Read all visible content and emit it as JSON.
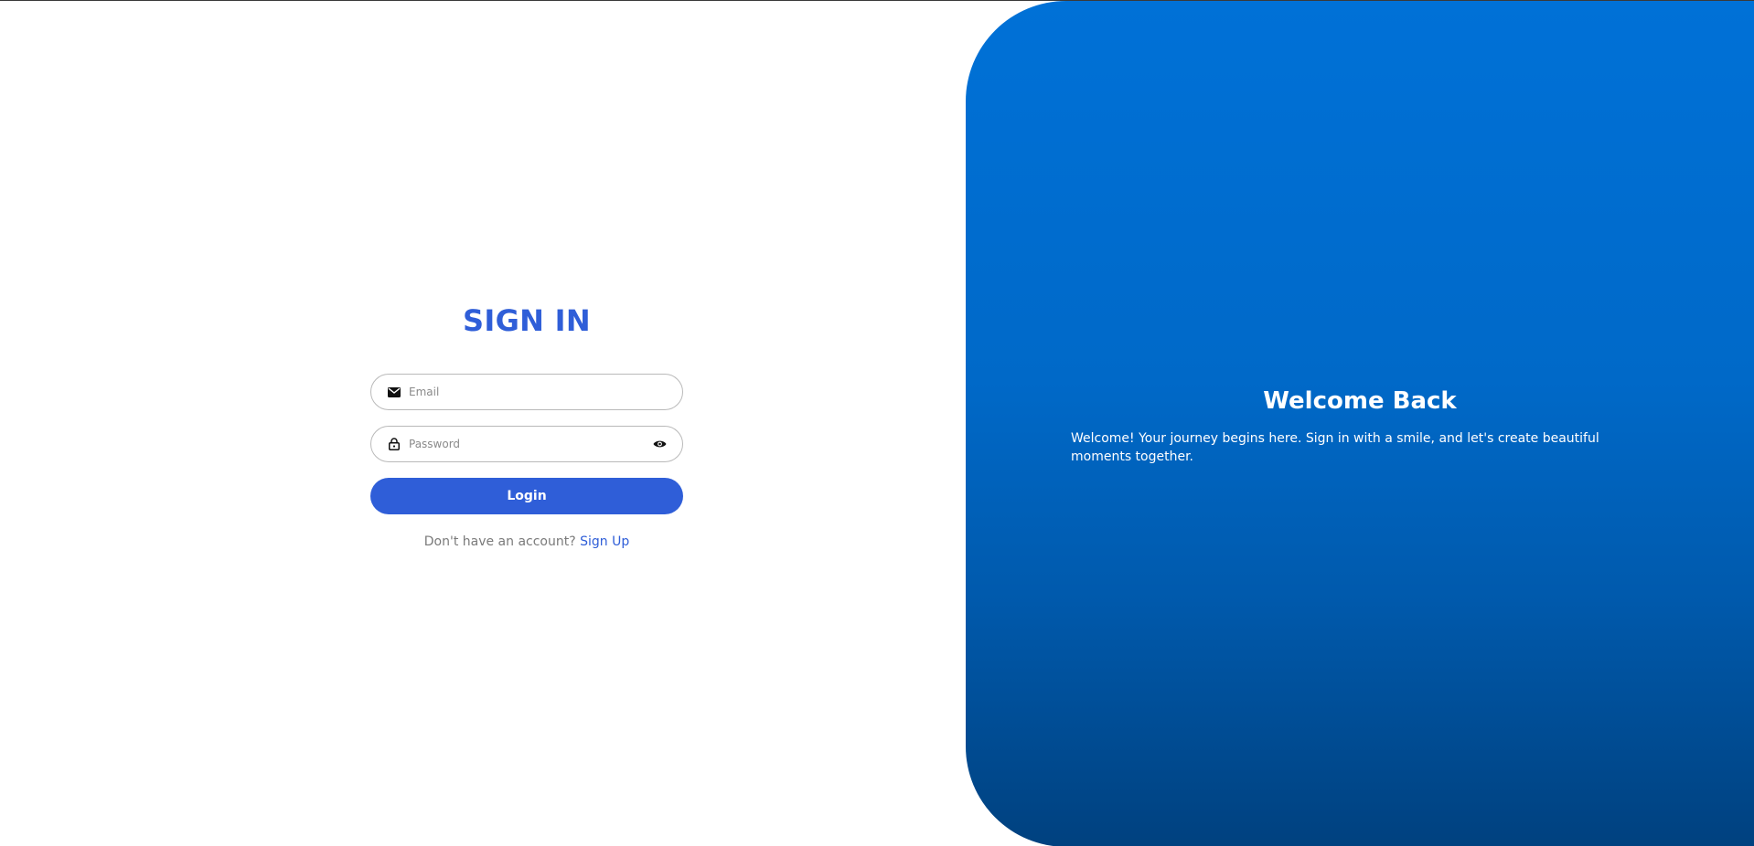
{
  "signin": {
    "title": "SIGN IN",
    "email": {
      "placeholder": "Email",
      "value": ""
    },
    "password": {
      "placeholder": "Password",
      "value": ""
    },
    "login_label": "Login",
    "signup_prompt": "Don't have an account?",
    "signup_link": "Sign Up"
  },
  "welcome": {
    "title": "Welcome Back",
    "text": "Welcome! Your journey begins here. Sign in with a smile, and let's create beautiful moments together."
  },
  "icons": {
    "email": "envelope-icon",
    "password": "lock-icon",
    "toggle": "eye-icon"
  },
  "colors": {
    "accent": "#2f5ed8",
    "panel_top": "#0071d7",
    "panel_bottom": "#00417f",
    "field_border": "#b9b9b9"
  }
}
